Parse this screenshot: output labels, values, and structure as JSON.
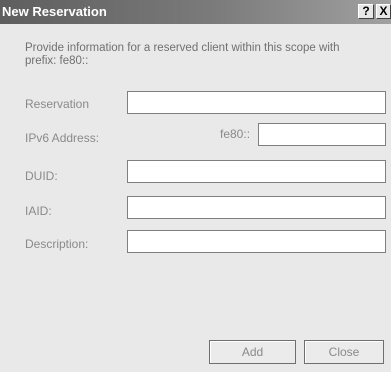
{
  "window": {
    "title": "New Reservation",
    "help_glyph": "?",
    "close_glyph": "X"
  },
  "intro_text": "Provide information for a reserved client within this scope with prefix:  fe80::",
  "form": {
    "reservation_label": "Reservation",
    "reservation_value": "",
    "ipv6_label": "IPv6 Address:",
    "ipv6_prefix": "fe80::",
    "ipv6_value": "",
    "duid_label": "DUID:",
    "duid_value": "",
    "iaid_label": "IAID:",
    "iaid_value": "",
    "description_label": "Description:",
    "description_value": ""
  },
  "buttons": {
    "add_label": "Add",
    "close_label": "Close"
  },
  "icons": {
    "help": "help-icon",
    "close": "close-icon"
  },
  "colors": {
    "titlebar": "#5e5e5e",
    "dialog_background": "#e9e9e9"
  }
}
